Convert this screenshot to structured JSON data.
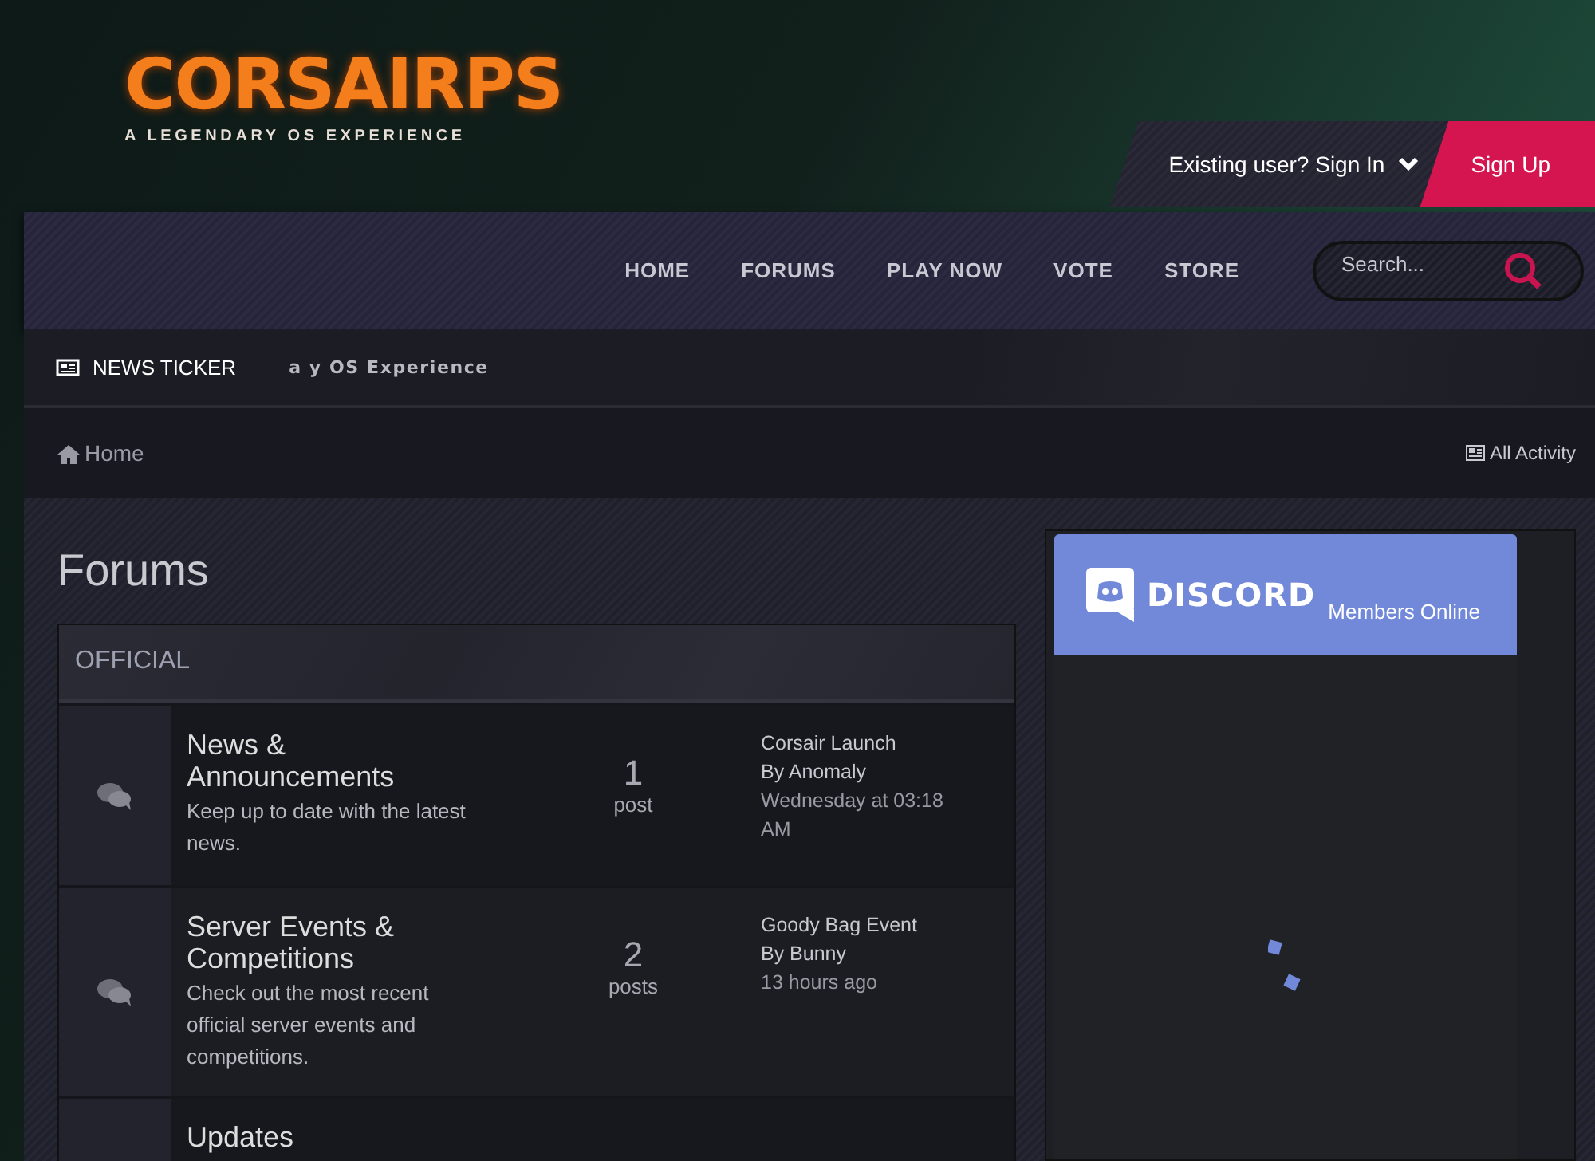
{
  "logo": {
    "title": "CORSAIRPS",
    "tagline": "A LEGENDARY OS EXPERIENCE"
  },
  "user_bar": {
    "sign_in": "Existing user? Sign In",
    "sign_up": "Sign Up"
  },
  "nav": {
    "items": [
      {
        "label": "HOME"
      },
      {
        "label": "FORUMS"
      },
      {
        "label": "PLAY NOW"
      },
      {
        "label": "VOTE"
      },
      {
        "label": "STORE"
      }
    ],
    "search": {
      "placeholder": "Search..."
    }
  },
  "ticker": {
    "label": "NEWS TICKER",
    "text": "a y OS Experience"
  },
  "breadcrumb": {
    "home": "Home",
    "all_activity": "All Activity"
  },
  "page_title": "Forums",
  "categories": [
    {
      "title": "OFFICIAL",
      "forums": [
        {
          "name": "News & Announcements",
          "description": "Keep up to date with the latest news.",
          "count": "1",
          "count_label": "post",
          "last_title": "Corsair Launch",
          "last_author": "By Anomaly",
          "last_time": "Wednesday at 03:18 AM"
        },
        {
          "name": "Server Events & Competitions",
          "description": "Check out the most recent official server events and competitions.",
          "count": "2",
          "count_label": "posts",
          "last_title": "Goody Bag Event",
          "last_author": "By Bunny",
          "last_time": "13 hours ago"
        },
        {
          "name": "Updates"
        }
      ]
    }
  ],
  "discord": {
    "logo": "DISCORD",
    "subtitle": "Members Online"
  }
}
